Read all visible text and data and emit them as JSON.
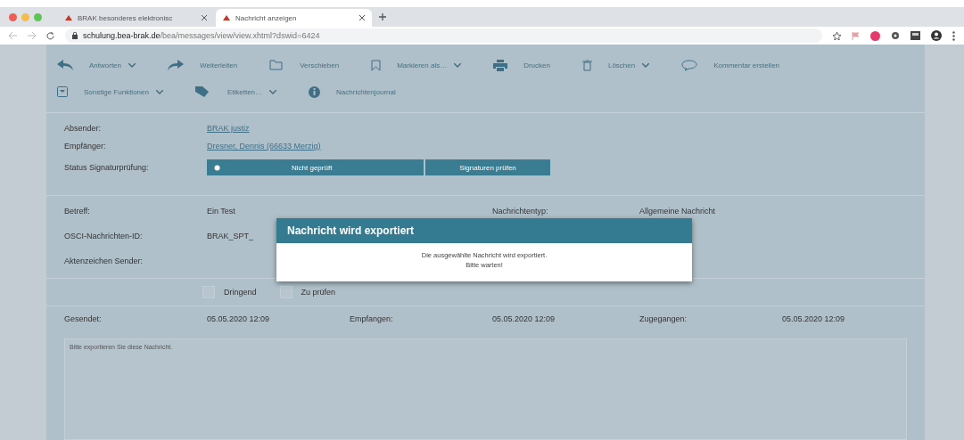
{
  "browser": {
    "tabs": [
      {
        "title": "BRAK besonderes elektronisc",
        "selected": false
      },
      {
        "title": "Nachricht anzeigen",
        "selected": true
      }
    ],
    "url_host": "schulung.bea-brak.de",
    "url_path": "/bea/messages/view/view.xhtml?dswid=6424"
  },
  "toolbar": [
    [
      {
        "label": "Antworten",
        "dropdown": true
      },
      {
        "label": "Weiterleiten",
        "dropdown": false
      },
      {
        "label": "Verschieben",
        "dropdown": false
      },
      {
        "label": "Markieren als…",
        "dropdown": true
      },
      {
        "label": "Drucken",
        "dropdown": false
      },
      {
        "label": "Löschen",
        "dropdown": true
      },
      {
        "label": "Kommentar erstellen",
        "dropdown": false
      }
    ],
    [
      {
        "label": "Sonstige Funktionen",
        "dropdown": true
      },
      {
        "label": "Etiketten…",
        "dropdown": true
      },
      {
        "label": "Nachrichtenjournal",
        "dropdown": false
      }
    ]
  ],
  "header": {
    "sender_label": "Absender:",
    "sender": "BRAK justiz",
    "recipient_label": "Empfänger:",
    "recipient": "Dresner, Dennis (66633 Merzig)",
    "status_label": "Status Signaturprüfung:",
    "status": "Nicht geprüft",
    "verify_button": "Signaturen prüfen"
  },
  "details": {
    "subject_label": "Betreff:",
    "subject": "Ein Test",
    "type_label": "Nachrichtentyp:",
    "type": "Allgemeine Nachricht",
    "osci_label": "OSCI-Nachrichten-ID:",
    "osci": "BRAK_SPT_",
    "ref_label": "Aktenzeichen Sender:"
  },
  "flags": [
    {
      "label": "Dringend",
      "checked": false
    },
    {
      "label": "Zu prüfen",
      "checked": false
    }
  ],
  "dates": [
    {
      "label": "Gesendet:",
      "value": "05.05.2020 12:09"
    },
    {
      "label": "Empfangen:",
      "value": "05.05.2020 12:09"
    },
    {
      "label": "Zugegangen:",
      "value": "05.05.2020 12:09"
    }
  ],
  "body": "Bitte exportieren Sie diese Nachricht.",
  "modal": {
    "title": "Nachricht wird exportiert",
    "lines": [
      "Die ausgewählte Nachricht wird exportiert.",
      "Bitte warten!"
    ]
  }
}
